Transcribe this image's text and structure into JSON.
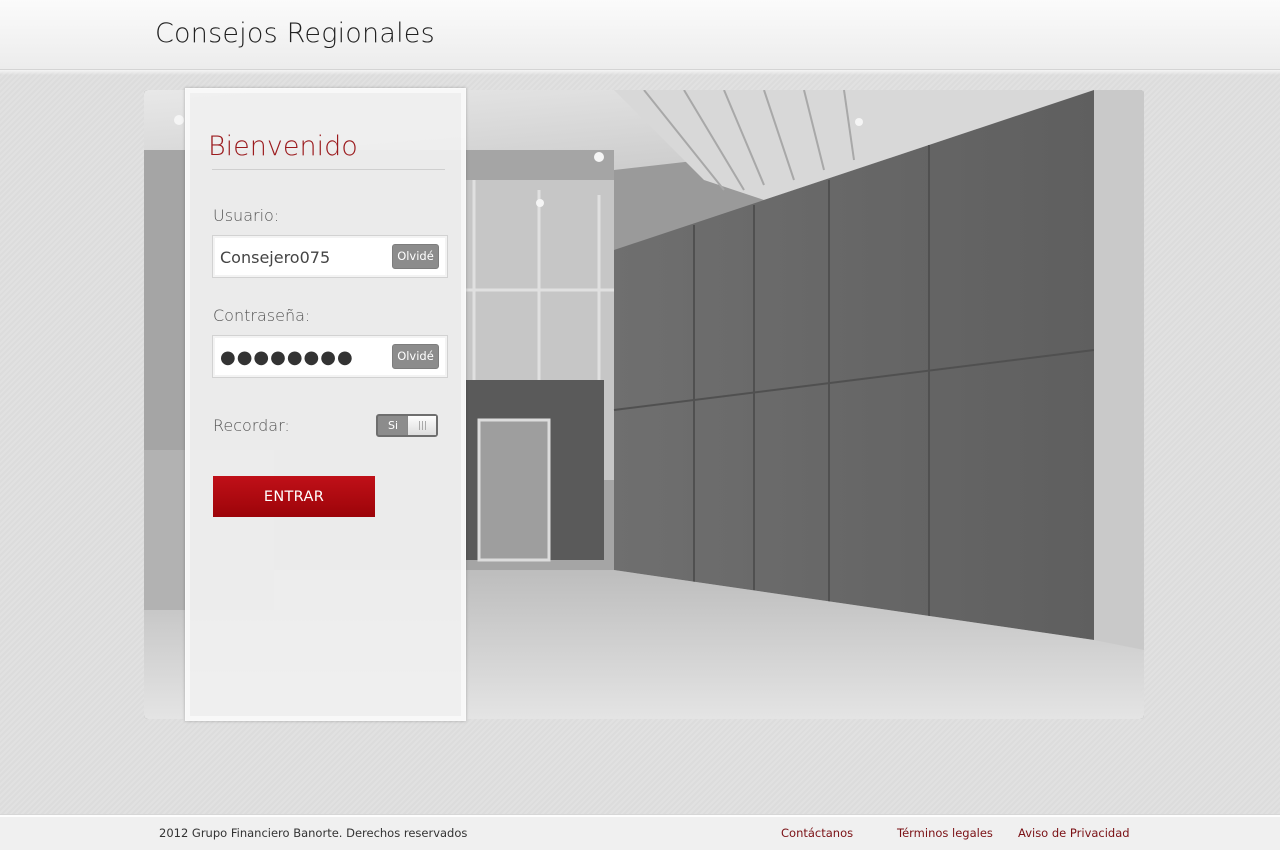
{
  "header": {
    "title": "Consejos Regionales"
  },
  "hero": {
    "image": "building-lobby-photo"
  },
  "login": {
    "heading": "Bienvenido",
    "user_label": "Usuario:",
    "user_value": "Consejero075",
    "user_forgot": "Olvidé",
    "password_label": "Contraseña:",
    "password_value": "●●●●●●●●",
    "password_forgot": "Olvidé",
    "remember_label": "Recordar:",
    "remember_toggle": "Si",
    "submit_label": "ENTRAR"
  },
  "footer": {
    "copyright": "2012 Grupo Financiero Banorte. Derechos reservados",
    "links": [
      "Contáctanos",
      "Términos legales",
      "Aviso de Privacidad"
    ]
  },
  "colors": {
    "accent": "#9b1a1d",
    "button": "#ae0a10",
    "neutral_button": "#8c8c8c"
  }
}
